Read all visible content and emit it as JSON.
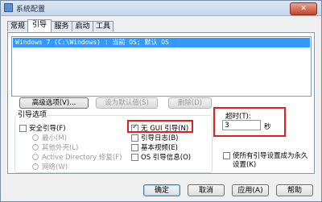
{
  "window": {
    "title": "系统配置",
    "close_glyph": "✕"
  },
  "tabs": [
    {
      "label": "常规"
    },
    {
      "label": "引导"
    },
    {
      "label": "服务"
    },
    {
      "label": "启动"
    },
    {
      "label": "工具"
    }
  ],
  "boot_list": {
    "entries": [
      "Windows 7 (C:\\Windows) : 当前 OS; 默认 OS"
    ]
  },
  "list_buttons": {
    "advanced": "高级选项(V)...",
    "set_default": "设为默认值(S)",
    "delete": "删除(D)"
  },
  "boot_options": {
    "group_label": "引导选项",
    "safe_boot": "安全引导(F)",
    "minimal": "最小(M)",
    "alternate_shell": "其他外壳(L)",
    "ad_repair": "Active Directory 修复(F)",
    "network": "网络(W)",
    "no_gui": "无 GUI 引导(N)",
    "boot_log": "引导日志(B)",
    "base_video": "基本视频(E)",
    "os_boot_info": "OS 引导信息(O)"
  },
  "timeout": {
    "label": "超时(T):",
    "value": "3",
    "unit": "秒"
  },
  "make_permanent": {
    "label_line1": "使所有引导设置成为永久",
    "label_line2": "设置(K)"
  },
  "footer": {
    "ok": "确定",
    "cancel": "取消",
    "apply": "应用(A)",
    "help": "帮助"
  },
  "colors": {
    "highlight": "#e02020",
    "selection": "#3399ff"
  }
}
